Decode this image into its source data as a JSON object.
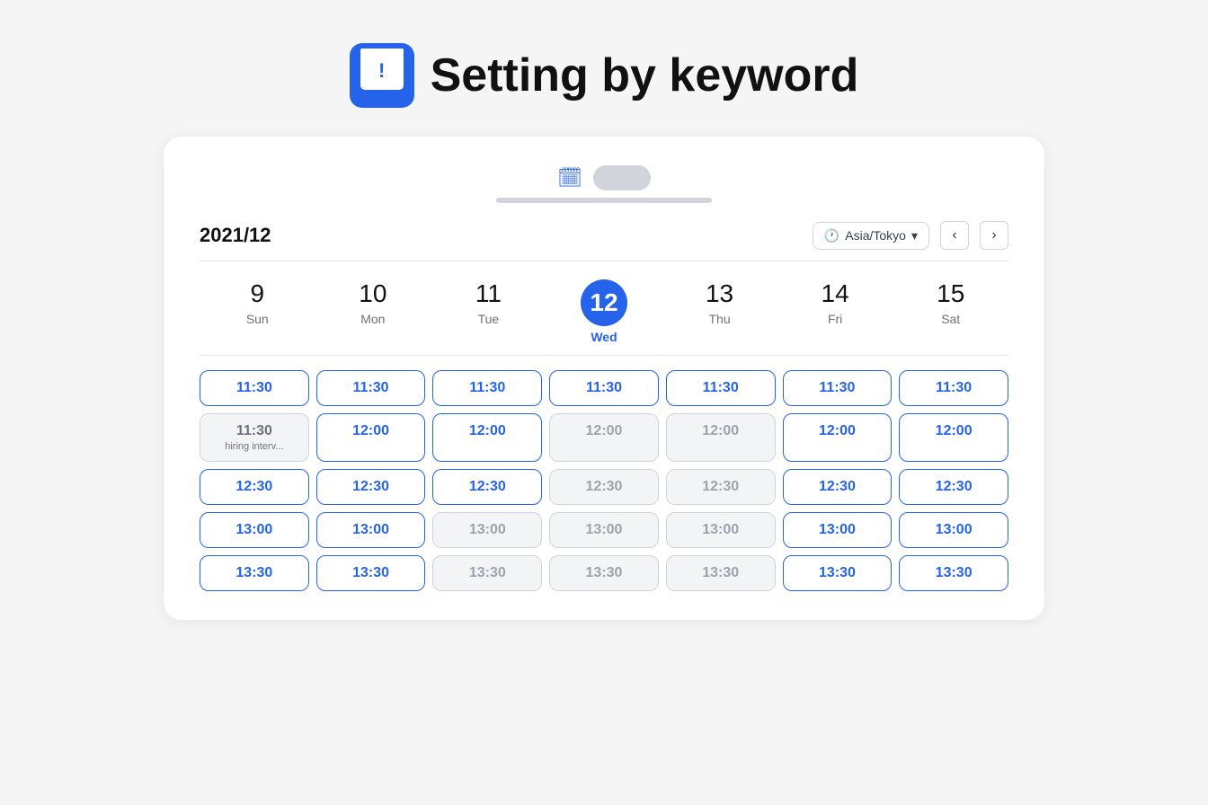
{
  "header": {
    "title": "Setting by keyword"
  },
  "card": {
    "month": "2021/12",
    "timezone": "Asia/Tokyo",
    "days": [
      {
        "num": "9",
        "name": "Sun",
        "today": false
      },
      {
        "num": "10",
        "name": "Mon",
        "today": false
      },
      {
        "num": "11",
        "name": "Tue",
        "today": false
      },
      {
        "num": "12",
        "name": "Wed",
        "today": true
      },
      {
        "num": "13",
        "name": "Thu",
        "today": false
      },
      {
        "num": "14",
        "name": "Fri",
        "today": false
      },
      {
        "num": "15",
        "name": "Sat",
        "today": false
      }
    ],
    "timeRows": [
      {
        "slots": [
          {
            "time": "11:30",
            "state": "active"
          },
          {
            "time": "11:30",
            "state": "active"
          },
          {
            "time": "11:30",
            "state": "active"
          },
          {
            "time": "11:30",
            "state": "active"
          },
          {
            "time": "11:30",
            "state": "active"
          },
          {
            "time": "11:30",
            "state": "active"
          },
          {
            "time": "11:30",
            "state": "active"
          }
        ]
      },
      {
        "slots": [
          {
            "time": "11:30",
            "state": "booked",
            "sub": "hiring interv..."
          },
          {
            "time": "12:00",
            "state": "active"
          },
          {
            "time": "12:00",
            "state": "active"
          },
          {
            "time": "12:00",
            "state": "disabled"
          },
          {
            "time": "12:00",
            "state": "disabled"
          },
          {
            "time": "12:00",
            "state": "active"
          },
          {
            "time": "12:00",
            "state": "active"
          }
        ]
      },
      {
        "slots": [
          {
            "time": "12:30",
            "state": "active"
          },
          {
            "time": "12:30",
            "state": "active"
          },
          {
            "time": "12:30",
            "state": "active"
          },
          {
            "time": "12:30",
            "state": "disabled"
          },
          {
            "time": "12:30",
            "state": "disabled"
          },
          {
            "time": "12:30",
            "state": "active"
          },
          {
            "time": "12:30",
            "state": "active"
          }
        ]
      },
      {
        "slots": [
          {
            "time": "13:00",
            "state": "active"
          },
          {
            "time": "13:00",
            "state": "active"
          },
          {
            "time": "13:00",
            "state": "disabled"
          },
          {
            "time": "13:00",
            "state": "disabled"
          },
          {
            "time": "13:00",
            "state": "disabled"
          },
          {
            "time": "13:00",
            "state": "active"
          },
          {
            "time": "13:00",
            "state": "active"
          }
        ]
      },
      {
        "slots": [
          {
            "time": "13:30",
            "state": "active"
          },
          {
            "time": "13:30",
            "state": "active"
          },
          {
            "time": "13:30",
            "state": "disabled"
          },
          {
            "time": "13:30",
            "state": "disabled"
          },
          {
            "time": "13:30",
            "state": "disabled"
          },
          {
            "time": "13:30",
            "state": "active"
          },
          {
            "time": "13:30",
            "state": "active"
          }
        ]
      }
    ]
  },
  "nav": {
    "prev_label": "‹",
    "next_label": "›"
  }
}
